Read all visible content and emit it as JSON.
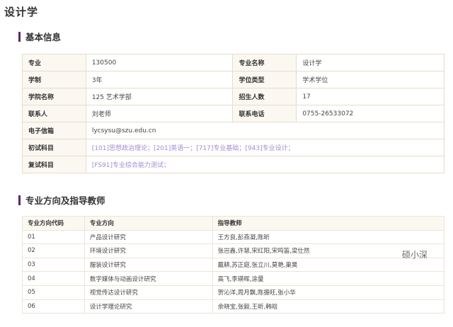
{
  "page_title": "设计学",
  "basic_info": {
    "heading": "基本信息",
    "rows": [
      [
        "专业",
        "130500",
        "专业名称",
        "设计学"
      ],
      [
        "学制",
        "3年",
        "学位类型",
        "学术学位"
      ],
      [
        "学院名称",
        "125 艺术学部",
        "招生人数",
        "17"
      ],
      [
        "联系人",
        "刘老师",
        "联系电话",
        "0755-26533072"
      ]
    ],
    "email_label": "电子信箱",
    "email_value": "lycsysu@szu.edu.cn",
    "first_exam_label": "初试科目",
    "first_exam_value": "[101]思想政治理论；[201]英语一；[717]专业基础；[943]专业设计；",
    "second_exam_label": "复试科目",
    "second_exam_value": "[FS91]专业综合能力测试；"
  },
  "directions": {
    "heading": "专业方向及指导教师",
    "columns": [
      "专业方向代码",
      "专业方向",
      "指导教师"
    ],
    "rows": [
      [
        "01",
        "产品设计研究",
        "王方良,彭燕凝,陈昕"
      ],
      [
        "02",
        "环境设计研究",
        "张岂鑫,许慧,宋红阳,宋鸣笛,梁仕然"
      ],
      [
        "03",
        "服装设计研究",
        "戴耕,苏正庭,张立川,莫艳,巢昊"
      ],
      [
        "04",
        "数字媒体与动画设计研究",
        "高飞,李瑛晖,涂量"
      ],
      [
        "05",
        "视觉传达设计研究",
        "贺沁洋,周月飘,陈振旺,张小华"
      ],
      [
        "06",
        "设计学理论研究",
        "余晓宝,张毅,王昕,韩晗"
      ]
    ]
  },
  "watermark": "硕小深",
  "colors": {
    "accent_bar": "#5a2a6e",
    "subject_link": "#a58ccf",
    "key_cell_bg": "#fbf8f2",
    "border": "#e6dccb"
  }
}
